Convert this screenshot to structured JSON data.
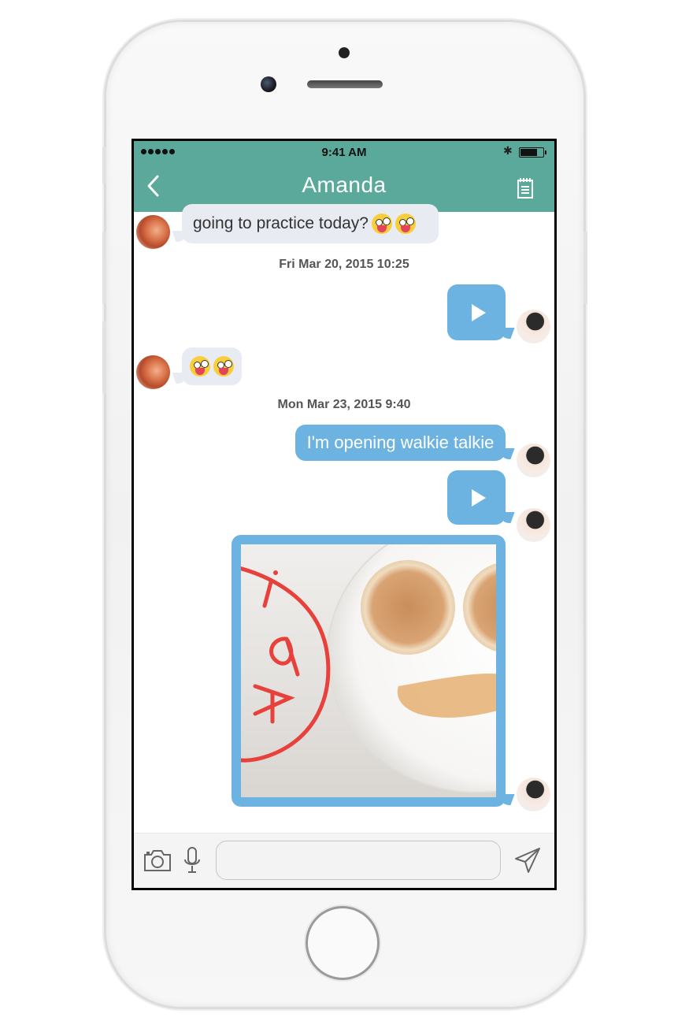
{
  "status_bar": {
    "time": "9:41 AM",
    "battery_level": 0.8
  },
  "nav": {
    "title": "Amanda",
    "back_icon": "chevron-left-icon",
    "notes_icon": "notes-icon"
  },
  "messages": {
    "msg1_text": "going to practice today?",
    "timestamp1": "Fri Mar 20, 2015 10:25",
    "timestamp2": "Mon Mar 23, 2015 9:40",
    "msg_text_out": "I'm opening walkie talkie"
  },
  "input": {
    "placeholder": ""
  },
  "colors": {
    "accent": "#5aa99b",
    "outgoing_bubble": "#6cb3e2",
    "incoming_bubble": "#e9ebf2"
  }
}
